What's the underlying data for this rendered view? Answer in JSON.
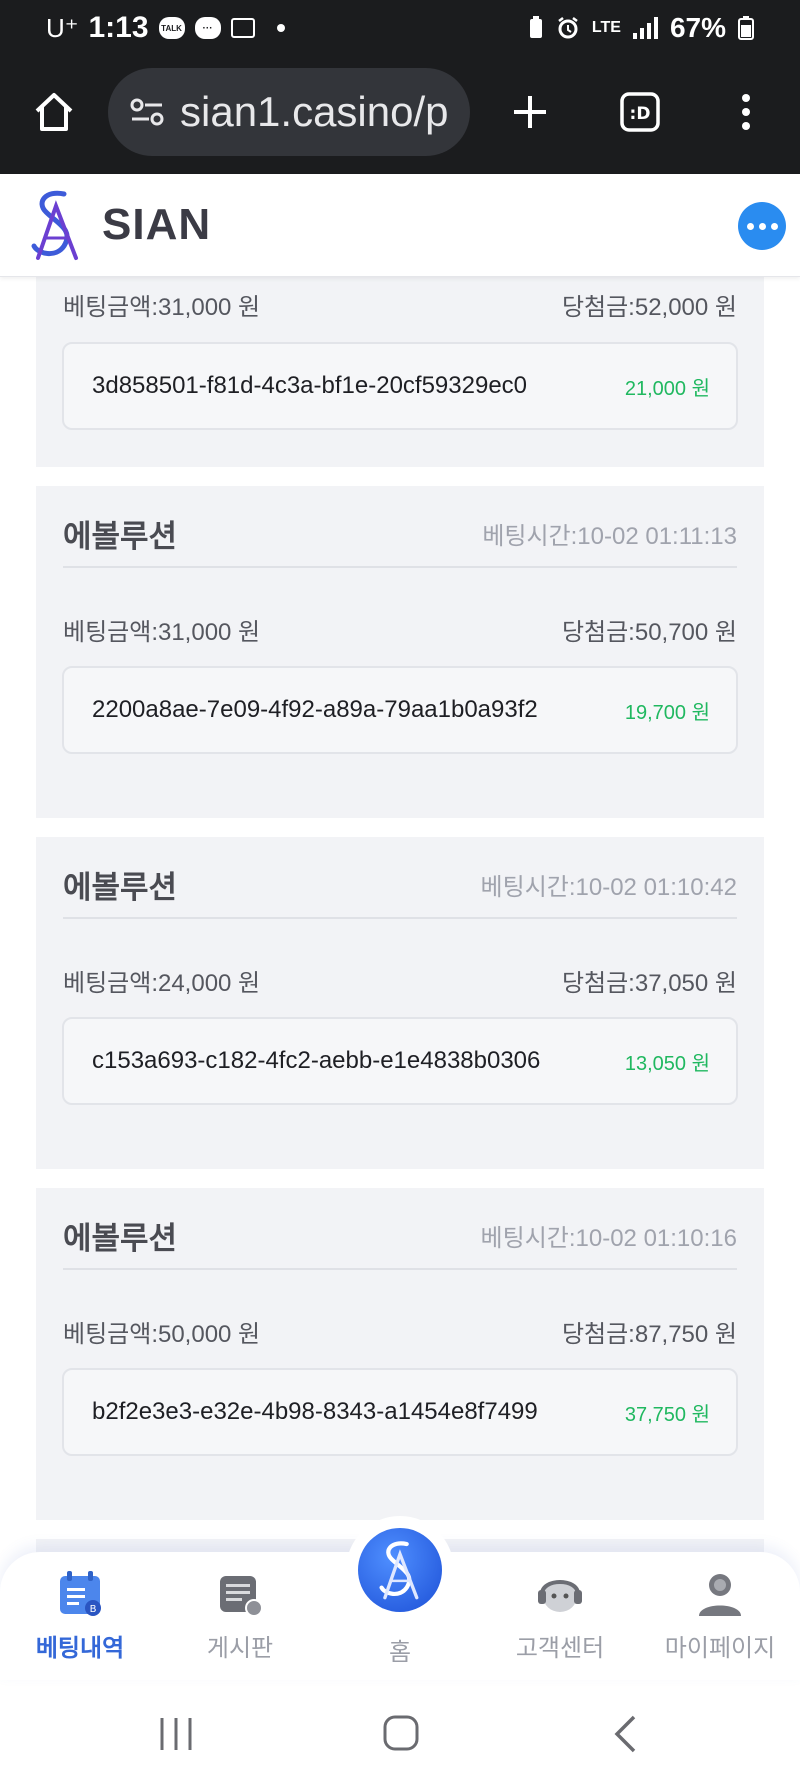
{
  "status_bar": {
    "carrier": "U⁺",
    "time": "1:13",
    "talk_icon_text": "TALK",
    "network": "LTE",
    "battery": "67%"
  },
  "browser": {
    "url": "sian1.casino/p"
  },
  "site": {
    "logo_text": "SIAN"
  },
  "bets": [
    {
      "game": "",
      "time": "",
      "bet_amount": "베팅금액:31,000 원",
      "win_amount": "당첨금:52,000 원",
      "bet_id": "3d858501-f81d-4c3a-bf1e-20cf59329ec0",
      "profit": "21,000 원"
    },
    {
      "game": "에볼루션",
      "time": "베팅시간:10-02 01:11:13",
      "bet_amount": "베팅금액:31,000 원",
      "win_amount": "당첨금:50,700 원",
      "bet_id": "2200a8ae-7e09-4f92-a89a-79aa1b0a93f2",
      "profit": "19,700 원"
    },
    {
      "game": "에볼루션",
      "time": "베팅시간:10-02 01:10:42",
      "bet_amount": "베팅금액:24,000 원",
      "win_amount": "당첨금:37,050 원",
      "bet_id": "c153a693-c182-4fc2-aebb-e1e4838b0306",
      "profit": "13,050 원"
    },
    {
      "game": "에볼루션",
      "time": "베팅시간:10-02 01:10:16",
      "bet_amount": "베팅금액:50,000 원",
      "win_amount": "당첨금:87,750 원",
      "bet_id": "b2f2e3e3-e32e-4b98-8343-a1454e8f7499",
      "profit": "37,750 원"
    }
  ],
  "bottom_nav": {
    "items": [
      {
        "label": "베팅내역",
        "icon": "bet-history-icon",
        "active": true
      },
      {
        "label": "게시판",
        "icon": "board-icon",
        "active": false
      },
      {
        "label": "홈",
        "icon": "home-logo-icon",
        "active": false
      },
      {
        "label": "고객센터",
        "icon": "customer-center-icon",
        "active": false
      },
      {
        "label": "마이페이지",
        "icon": "my-page-icon",
        "active": false
      }
    ]
  },
  "colors": {
    "accent": "#3468d8",
    "profit": "#20b860",
    "card_bg": "#f2f3f6",
    "status_bg": "#1b1c1e"
  }
}
